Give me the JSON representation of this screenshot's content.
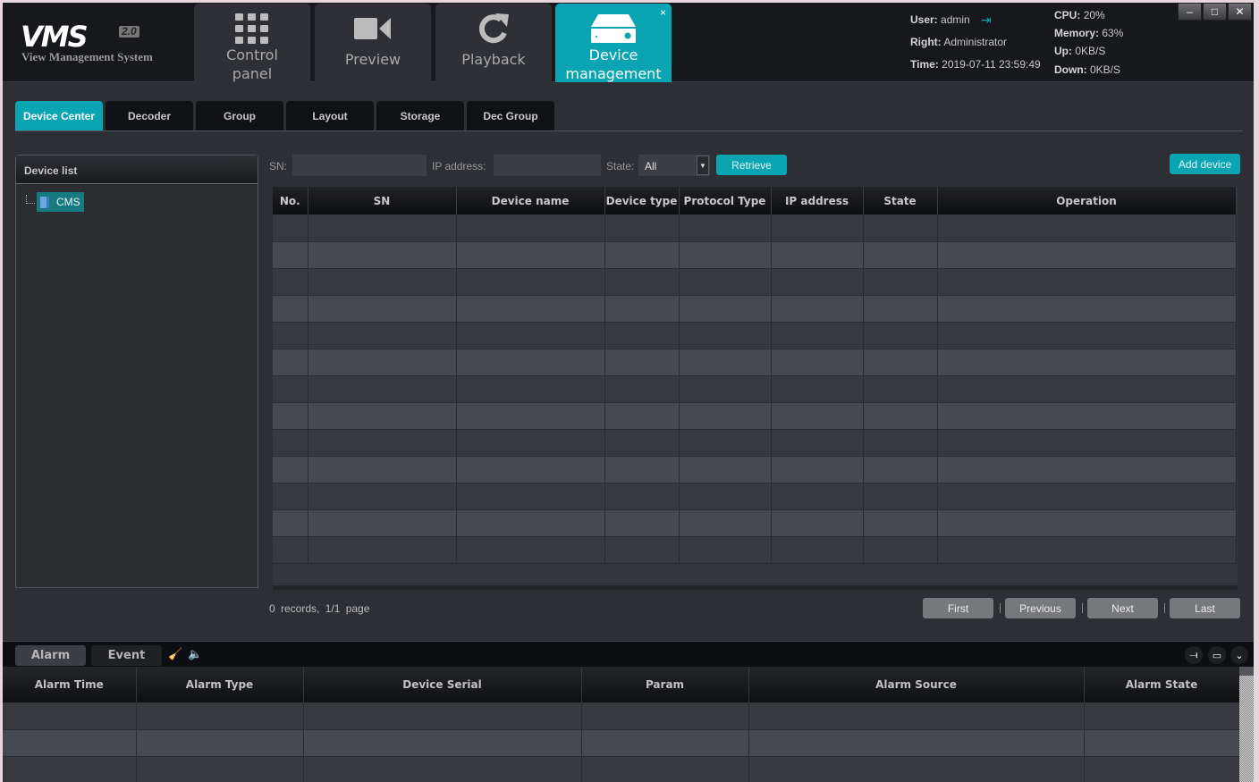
{
  "app": {
    "logo_main": "VMS",
    "logo_version": "2.0",
    "logo_subtitle": "View Management System"
  },
  "nav": [
    {
      "label": "Control panel",
      "icon": "grid-icon",
      "active": false
    },
    {
      "label": "Preview",
      "icon": "video-camera-icon",
      "active": false
    },
    {
      "label": "Playback",
      "icon": "refresh-icon",
      "active": false
    },
    {
      "label": "Device management",
      "icon": "hard-drive-icon",
      "active": true,
      "close": "×"
    }
  ],
  "status": {
    "user_label": "User:",
    "user": "admin",
    "right_label": "Right:",
    "right": "Administrator",
    "time_label": "Time:",
    "time": "2019-07-11 23:59:49",
    "cpu_label": "CPU:",
    "cpu": "20%",
    "memory_label": "Memory:",
    "memory": "63%",
    "up_label": "Up:",
    "up": "0KB/S",
    "down_label": "Down:",
    "down": "0KB/S"
  },
  "window_controls": {
    "minimize": "–",
    "maximize": "□",
    "close": "✕"
  },
  "tabs": [
    "Device Center",
    "Decoder",
    "Group",
    "Layout",
    "Storage",
    "Dec Group"
  ],
  "active_tab": "Device Center",
  "device_list": {
    "title": "Device list",
    "nodes": [
      {
        "label": "CMS"
      }
    ]
  },
  "search": {
    "sn_label": "SN:",
    "sn_value": "",
    "ip_label": "IP address:",
    "ip_value": "",
    "state_label": "State:",
    "state_value": "All",
    "retrieve": "Retrieve",
    "add_device": "Add device"
  },
  "device_table": {
    "columns": [
      "No.",
      "SN",
      "Device name",
      "Device type",
      "Protocol Type",
      "IP address",
      "State",
      "Operation"
    ],
    "rows": []
  },
  "pagination": {
    "summary": "0 records, 1/1 page",
    "first": "First",
    "previous": "Previous",
    "next": "Next",
    "last": "Last"
  },
  "alarm_panel": {
    "tabs": [
      "Alarm",
      "Event"
    ],
    "active_tab": "Alarm",
    "columns": [
      "Alarm Time",
      "Alarm Type",
      "Device Serial",
      "Param",
      "Alarm Source",
      "Alarm State"
    ],
    "rows": []
  },
  "colors": {
    "accent": "#0ba4b2",
    "header_bg": "#17181c",
    "panel_bg": "#2d2f34"
  }
}
